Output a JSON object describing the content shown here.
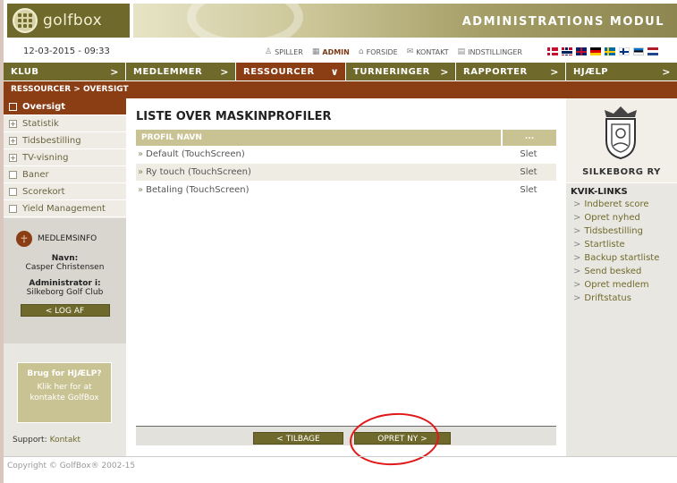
{
  "header": {
    "logo_text": "golfbox",
    "title": "ADMINISTRATIONS MODUL"
  },
  "topbar": {
    "datetime": "12-03-2015 - 09:33",
    "links": [
      {
        "label": "SPILLER",
        "icon": "person-icon"
      },
      {
        "label": "ADMIN",
        "icon": "grid-icon",
        "active": true
      },
      {
        "label": "FORSIDE",
        "icon": "house-icon"
      },
      {
        "label": "KONTAKT",
        "icon": "envelope-icon"
      },
      {
        "label": "INDSTILLINGER",
        "icon": "document-icon"
      }
    ],
    "flags": [
      "dk",
      "no",
      "uk",
      "de",
      "se",
      "fi",
      "ee",
      "nl"
    ]
  },
  "nav": {
    "items": [
      {
        "label": "KLUB",
        "chevron": ">"
      },
      {
        "label": "MEDLEMMER",
        "chevron": ">"
      },
      {
        "label": "RESSOURCER",
        "chevron": "∨",
        "active": true
      },
      {
        "label": "TURNERINGER",
        "chevron": ">"
      },
      {
        "label": "RAPPORTER",
        "chevron": ">"
      },
      {
        "label": "HJÆLP",
        "chevron": ">"
      }
    ]
  },
  "breadcrumb": "RESSOURCER > OVERSIGT",
  "sidebar": {
    "items": [
      {
        "label": "Oversigt",
        "mark": "",
        "active": true
      },
      {
        "label": "Statistik",
        "mark": "+"
      },
      {
        "label": "Tidsbestilling",
        "mark": "+"
      },
      {
        "label": "TV-visning",
        "mark": "+"
      },
      {
        "label": "Baner",
        "mark": ""
      },
      {
        "label": "Scorekort",
        "mark": ""
      },
      {
        "label": "Yield Management",
        "mark": ""
      }
    ],
    "member": {
      "heading": "MEDLEMSINFO",
      "name_label": "Navn:",
      "name": "Casper Christensen",
      "admin_label": "Administrator i:",
      "club": "Silkeborg Golf Club",
      "logout": "< LOG AF"
    },
    "help": {
      "title": "Brug for HJÆLP?",
      "line1": "Klik her for at",
      "line2": "kontakte GolfBox"
    },
    "support": {
      "label": "Support:",
      "link": "Kontakt"
    }
  },
  "main": {
    "title": "LISTE OVER MASKINPROFILER",
    "table": {
      "headers": [
        "PROFIL NAVN",
        "..."
      ],
      "rows": [
        {
          "name": "Default (TouchScreen)",
          "action": "Slet"
        },
        {
          "name": "Ry touch (TouchScreen)",
          "action": "Slet"
        },
        {
          "name": "Betaling (TouchScreen)",
          "action": "Slet"
        }
      ]
    },
    "buttons": {
      "back": "< TILBAGE",
      "create": "OPRET NY >"
    }
  },
  "right": {
    "club": "SILKEBORG RY",
    "quick_title": "KVIK-LINKS",
    "links": [
      "Indberet score",
      "Opret nyhed",
      "Tidsbestilling",
      "Startliste",
      "Backup startliste",
      "Send besked",
      "Opret medlem",
      "Driftstatus"
    ]
  },
  "footer": "Copyright © GolfBox® 2002-15",
  "colors": {
    "olive": "#6f6a2c",
    "brown": "#8b3d14",
    "khaki": "#c9c394",
    "highlight_circle": "#e01818"
  }
}
